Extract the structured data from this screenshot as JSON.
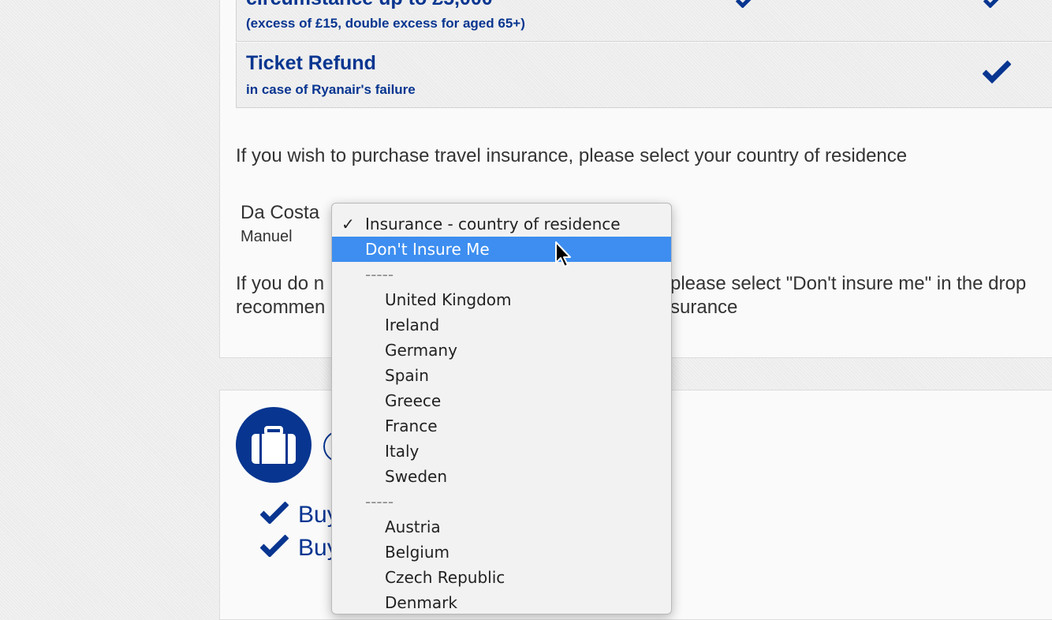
{
  "benefits": {
    "excess_title": "circumstance up to £5,000",
    "excess_subtitle": "(excess of £15, double excess for aged 65+)",
    "refund_title": "Ticket Refund",
    "refund_subtitle": "in case of Ryanair's failure"
  },
  "insurance": {
    "select_prompt": "If you wish to purchase travel insurance, please select your country of residence",
    "passenger_last_name": "Da Costa",
    "passenger_first_name": "Manuel",
    "info_line1_left": "If you do n",
    "info_line1_right": "please select \"Don't insure me\" in the drop",
    "info_line2_left": "recommen",
    "info_line2_right": "surance"
  },
  "dropdown": {
    "checkmark": "✓",
    "header": "Insurance - country of residence",
    "highlighted": "Don't Insure Me",
    "separator": "-----",
    "group1": [
      "United Kingdom",
      "Ireland",
      "Germany",
      "Spain",
      "Greece",
      "France",
      "Italy",
      "Sweden"
    ],
    "group2": [
      "Austria",
      "Belgium",
      "Czech Republic",
      "Denmark"
    ]
  },
  "bags": {
    "buy_line1": "Buy",
    "buy_line2": "Buy"
  },
  "colors": {
    "brand_navy": "#073590",
    "highlight_blue": "#3d8ef0"
  }
}
